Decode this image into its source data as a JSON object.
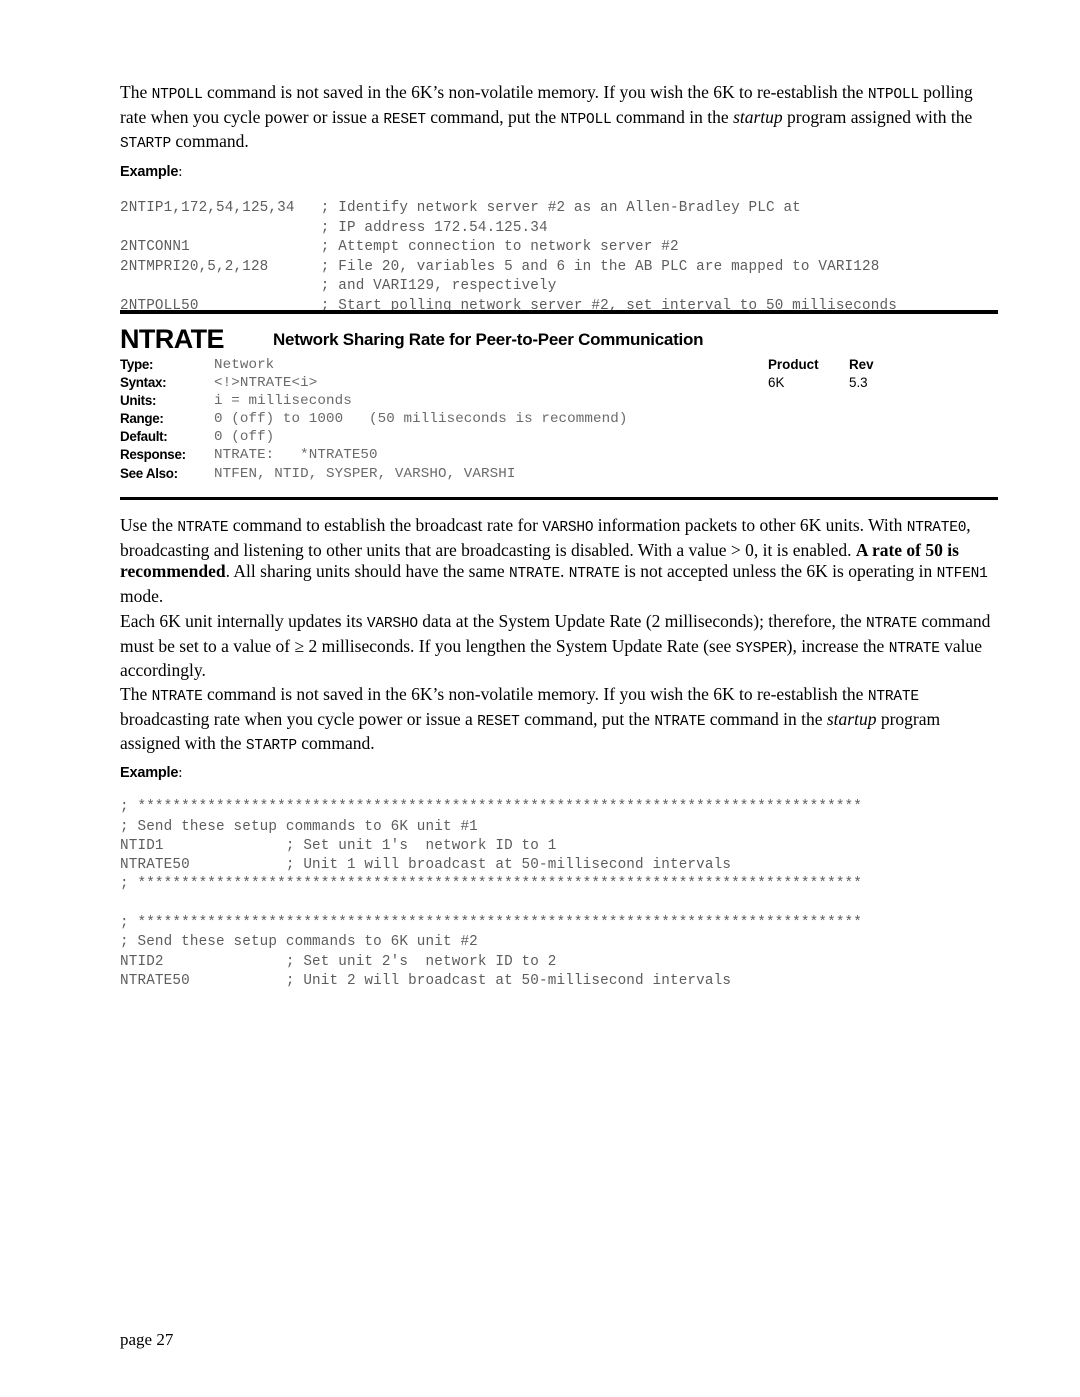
{
  "intro": {
    "segments": [
      {
        "t": "The ",
        "s": "serif"
      },
      {
        "t": "NTPOLL",
        "s": "cmd"
      },
      {
        "t": " command is not saved in the 6K’s non-volatile memory. If you wish the 6K to re-establish the ",
        "s": "serif"
      },
      {
        "t": "NTPOLL",
        "s": "cmd"
      },
      {
        "t": " polling rate when you cycle power or issue a ",
        "s": "serif"
      },
      {
        "t": "RESET",
        "s": "cmd"
      },
      {
        "t": " command, put the ",
        "s": "serif"
      },
      {
        "t": "NTPOLL",
        "s": "cmd"
      },
      {
        "t": " command in the ",
        "s": "serif"
      },
      {
        "t": "startup",
        "s": "ital"
      },
      {
        "t": " program assigned with the ",
        "s": "serif"
      },
      {
        "t": "STARTP",
        "s": "cmd"
      },
      {
        "t": " command.",
        "s": "serif"
      }
    ]
  },
  "example_top": {
    "label": "Example",
    "colon": ":",
    "code": "2NTIP1,172,54,125,34   ; Identify network server #2 as an Allen-Bradley PLC at\n                       ; IP address 172.54.125.34\n2NTCONN1               ; Attempt connection to network server #2\n2NTMPRI20,5,2,128      ; File 20, variables 5 and 6 in the AB PLC are mapped to VARI128\n                       ; and VARI129, respectively\n2NTPOLL50              ; Start polling network server #2, set interval to 50 milliseconds"
  },
  "command": {
    "name": "NTRATE",
    "title": "Network Sharing Rate for Peer-to-Peer Communication"
  },
  "spec": {
    "rows": [
      {
        "label": "Type:",
        "value": "Network"
      },
      {
        "label": "Syntax:",
        "value": "<!>NTRATE<i>"
      },
      {
        "label": "Units:",
        "value": "i = milliseconds"
      },
      {
        "label": "Range:",
        "value": "0 (off) to 1000   (50 milliseconds is recommend)"
      },
      {
        "label": "Default:",
        "value": "0 (off)"
      },
      {
        "label": "Response:",
        "value": "NTRATE:   *NTRATE50"
      },
      {
        "label": "See Also:",
        "value": "NTFEN, NTID, SYSPER, VARSHO, VARSHI"
      }
    ],
    "product_header": "Product",
    "rev_header": "Rev",
    "product_value": "6K",
    "rev_value": "5.3"
  },
  "para_1": {
    "segments": [
      {
        "t": "Use the ",
        "s": "serif"
      },
      {
        "t": "NTRATE",
        "s": "cmd"
      },
      {
        "t": " command to establish the broadcast rate for ",
        "s": "serif"
      },
      {
        "t": "VARSHO",
        "s": "cmd"
      },
      {
        "t": " information packets to other 6K units. With ",
        "s": "serif"
      },
      {
        "t": "NTRATE0",
        "s": "cmd"
      },
      {
        "t": ", broadcasting and listening to other units that are broadcasting is disabled. With a value > 0, it is enabled. ",
        "s": "serif"
      },
      {
        "t": "A rate of 50 is recommended",
        "s": "bold"
      },
      {
        "t": ". All sharing units should have the same ",
        "s": "serif"
      },
      {
        "t": "NTRATE",
        "s": "cmd"
      },
      {
        "t": ". ",
        "s": "serif"
      },
      {
        "t": "NTRATE",
        "s": "cmd"
      },
      {
        "t": " is not accepted unless the 6K is operating in ",
        "s": "serif"
      },
      {
        "t": "NTFEN1",
        "s": "cmd"
      },
      {
        "t": " mode.",
        "s": "serif"
      }
    ]
  },
  "para_2": {
    "segments": [
      {
        "t": "Each 6K unit internally updates its ",
        "s": "serif"
      },
      {
        "t": "VARSHO",
        "s": "cmd"
      },
      {
        "t": " data at the System Update Rate (2 milliseconds); therefore, the ",
        "s": "serif"
      },
      {
        "t": "NTRATE",
        "s": "cmd"
      },
      {
        "t": " command must be set to a value of ≥ 2 milliseconds. If you lengthen the System Update Rate (see ",
        "s": "serif"
      },
      {
        "t": "SYSPER",
        "s": "cmd"
      },
      {
        "t": "), increase the ",
        "s": "serif"
      },
      {
        "t": "NTRATE",
        "s": "cmd"
      },
      {
        "t": " value accordingly.",
        "s": "serif"
      }
    ]
  },
  "para_3": {
    "segments": [
      {
        "t": "The ",
        "s": "serif"
      },
      {
        "t": "NTRATE",
        "s": "cmd"
      },
      {
        "t": " command is not saved in the 6K’s non-volatile memory. If you wish the 6K to re-establish the ",
        "s": "serif"
      },
      {
        "t": "NTRATE",
        "s": "cmd"
      },
      {
        "t": " broadcasting rate when you cycle power or issue a ",
        "s": "serif"
      },
      {
        "t": "RESET",
        "s": "cmd"
      },
      {
        "t": " command, put the ",
        "s": "serif"
      },
      {
        "t": "NTRATE",
        "s": "cmd"
      },
      {
        "t": " command in the ",
        "s": "serif"
      },
      {
        "t": "startup",
        "s": "ital"
      },
      {
        "t": " program assigned with the ",
        "s": "serif"
      },
      {
        "t": "STARTP",
        "s": "cmd"
      },
      {
        "t": " command.",
        "s": "serif"
      }
    ]
  },
  "example_bottom": {
    "label": "Example",
    "colon": ":",
    "code": "; ***********************************************************************************\n; Send these setup commands to 6K unit #1\nNTID1              ; Set unit 1's  network ID to 1\nNTRATE50           ; Unit 1 will broadcast at 50-millisecond intervals\n; ***********************************************************************************\n\n; ***********************************************************************************\n; Send these setup commands to 6K unit #2\nNTID2              ; Set unit 2's  network ID to 2\nNTRATE50           ; Unit 2 will broadcast at 50-millisecond intervals"
  },
  "footer": {
    "page_label": "page 27"
  }
}
